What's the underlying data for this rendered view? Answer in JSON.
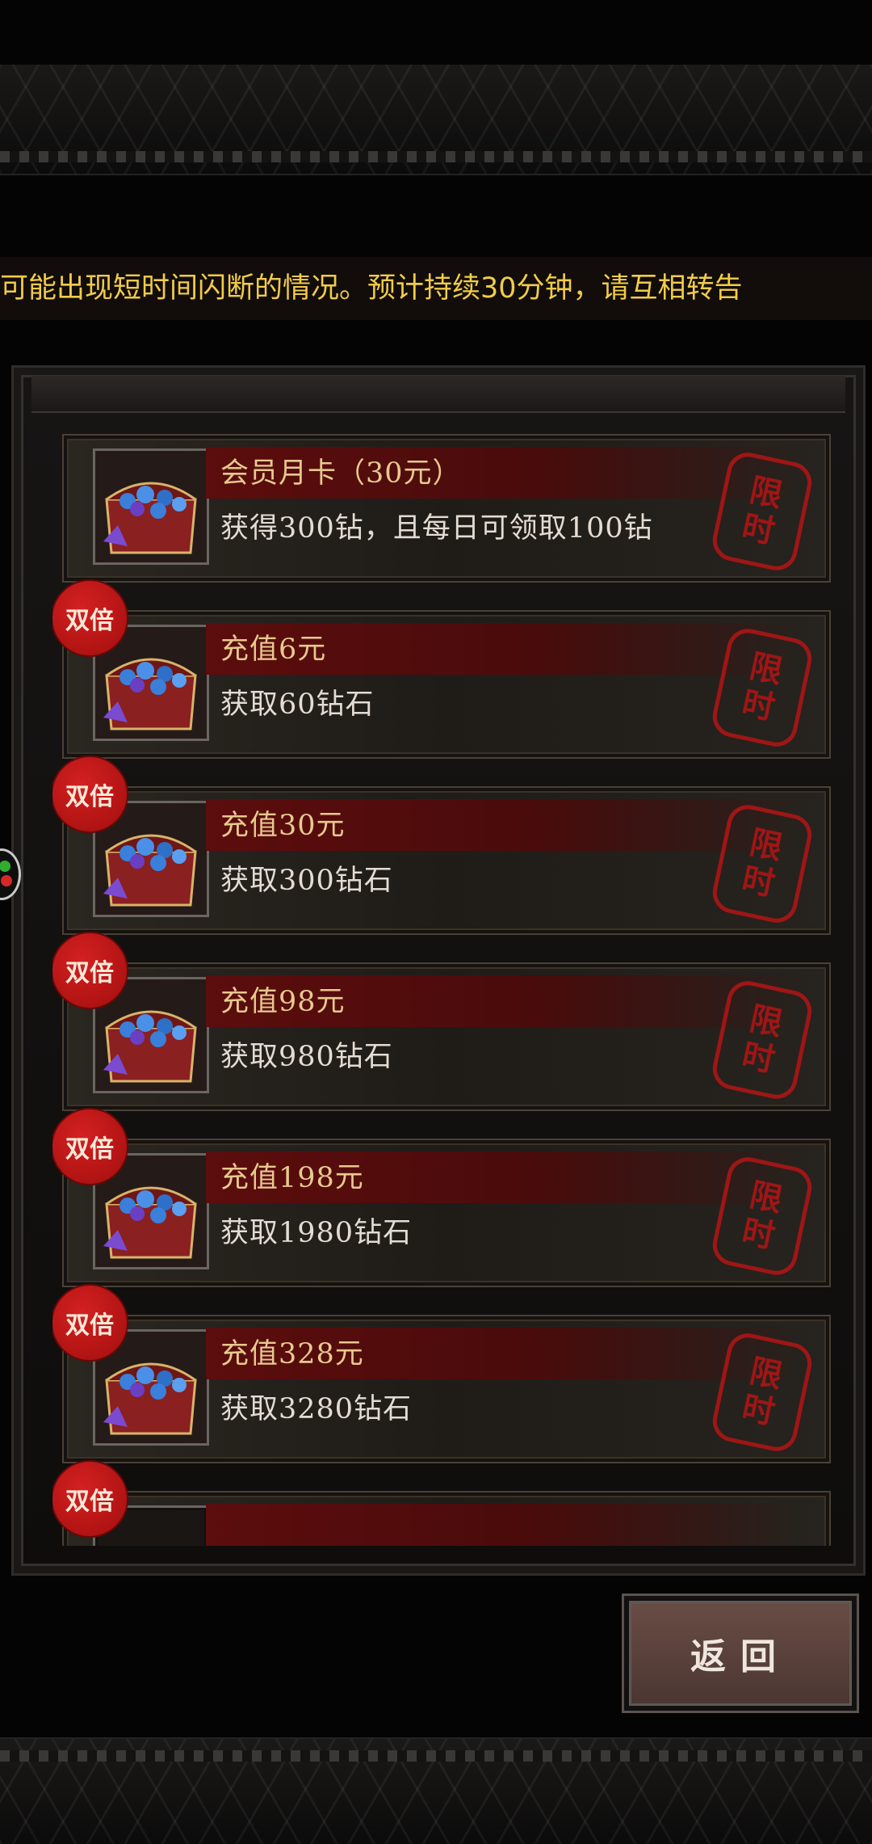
{
  "marquee": {
    "text": "可能出现短时间闪断的情况。预计持续30分钟，请互相转告"
  },
  "stamp_text": [
    "限",
    "时"
  ],
  "items": [
    {
      "badge": "",
      "name": "会员月卡（30元）",
      "desc": "获得300钻，且每日可领取100钻"
    },
    {
      "badge": "双倍",
      "name": "充值6元",
      "desc": "获取60钻石"
    },
    {
      "badge": "双倍",
      "name": "充值30元",
      "desc": "获取300钻石"
    },
    {
      "badge": "双倍",
      "name": "充值98元",
      "desc": "获取980钻石"
    },
    {
      "badge": "双倍",
      "name": "充值198元",
      "desc": "获取1980钻石"
    },
    {
      "badge": "双倍",
      "name": "充值328元",
      "desc": "获取3280钻石"
    },
    {
      "badge": "双倍",
      "name": "",
      "desc": ""
    }
  ],
  "back_button": {
    "label": "返回"
  },
  "colors": {
    "accent_gold": "#e7c98f",
    "stamp_red": "#9e1616",
    "badge_red": "#c41818",
    "marquee_yellow": "#f1cc4a"
  },
  "icons": {
    "item_thumb": "gem-chest-icon",
    "side": "floating-assistant-icon"
  }
}
